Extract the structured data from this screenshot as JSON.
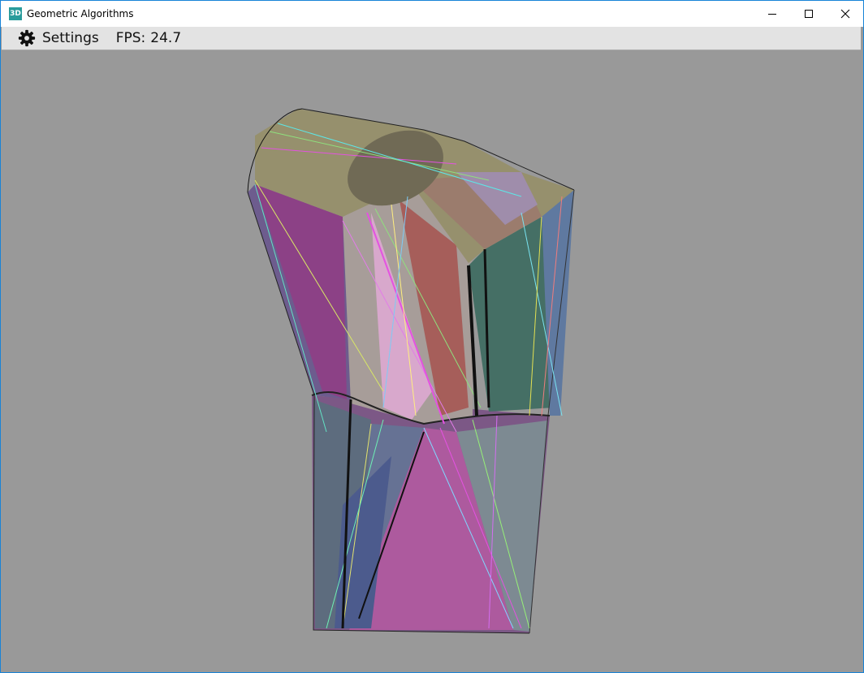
{
  "window": {
    "title": "Geometric Algorithms",
    "app_icon_text": "3D",
    "controls": [
      "minimize-icon",
      "maximize-icon",
      "close-icon"
    ]
  },
  "menubar": {
    "settings_icon": "gear-icon",
    "settings_label": "Settings",
    "fps_label": "FPS:",
    "fps_value": "24.7"
  },
  "viewport": {
    "background": "#999999",
    "model_colors": [
      "#8e3f82",
      "#6a6096",
      "#ac628c",
      "#4a7468",
      "#a55e5b",
      "#9d9d94",
      "#636bb0",
      "#e452e1",
      "#8fe07d"
    ]
  }
}
